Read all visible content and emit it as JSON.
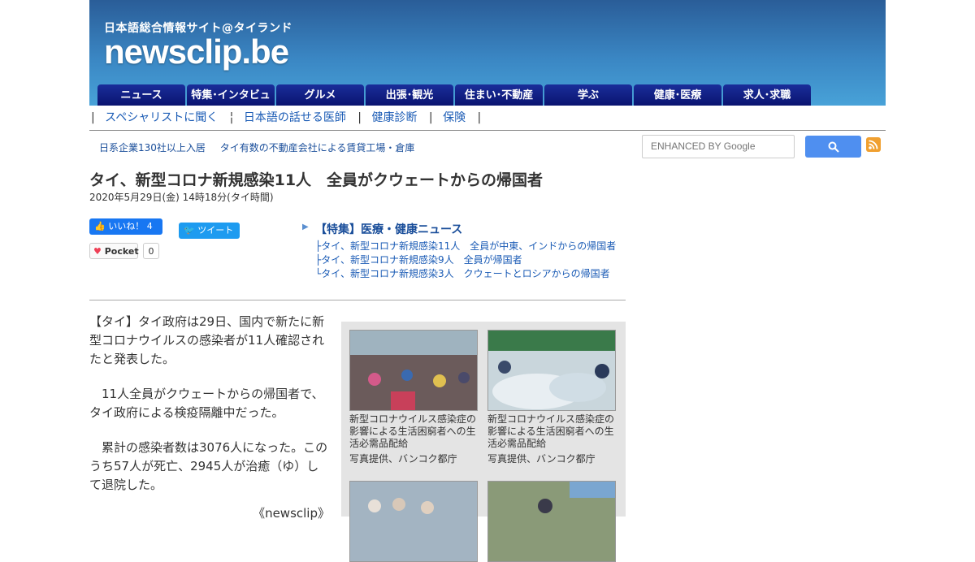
{
  "header": {
    "tagline": "日本語総合情報サイト@タイランド",
    "logo": "newsclip.be"
  },
  "nav": [
    "ニュース",
    "特集･インタビュー",
    "グルメ",
    "出張･観光",
    "住まい･不動産",
    "学ぶ",
    "健康･医療",
    "求人･求職"
  ],
  "subnav": {
    "sep": "|",
    "links": [
      "スペシャリストに聞く",
      "日本語の話せる医師",
      "健康診断",
      "保険"
    ]
  },
  "ad": {
    "text1": "日系企業130社以上入居",
    "text2": "タイ有数の不動産会社による賃貸工場・倉庫"
  },
  "search": {
    "placeholder": "ENHANCED BY Google"
  },
  "article": {
    "title": "タイ、新型コロナ新規感染11人　全員がクウェートからの帰国者",
    "date": "2020年5月29日(金) 14時18分(タイ時間)",
    "paragraphs": [
      "【タイ】タイ政府は29日、国内で新たに新型コロナウイルスの感染者が11人確認されたと発表した。",
      "　11人全員がクウェートからの帰国者で、タイ政府による検疫隔離中だった。",
      "　累計の感染者数は3076人になった。このうち57人が死亡、2945人が治癒（ゆ）して退院した。"
    ],
    "source": "《newsclip》"
  },
  "social": {
    "fb_label": "いいね！ 4",
    "tw_label": "ツイート",
    "pocket_label": "Pocket",
    "pocket_count": "0"
  },
  "related": {
    "heading": "【特集】医療・健康ニュース",
    "items": [
      "├タイ、新型コロナ新規感染11人　全員が中東、インドからの帰国者",
      "├タイ、新型コロナ新規感染9人　全員が帰国者",
      "└タイ、新型コロナ新規感染3人　クウェートとロシアからの帰国者"
    ]
  },
  "gallery": [
    {
      "caption": "新型コロナウイルス感染症の影響による生活困窮者への生活必需品配給",
      "credit": "写真提供、バンコク都庁"
    },
    {
      "caption": "新型コロナウイルス感染症の影響による生活困窮者への生活必需品配給",
      "credit": "写真提供、バンコク都庁"
    }
  ],
  "colors": {
    "nav_bg": "#0a1470",
    "link": "#1a5bb5",
    "header_bg": "#3a86c3"
  }
}
